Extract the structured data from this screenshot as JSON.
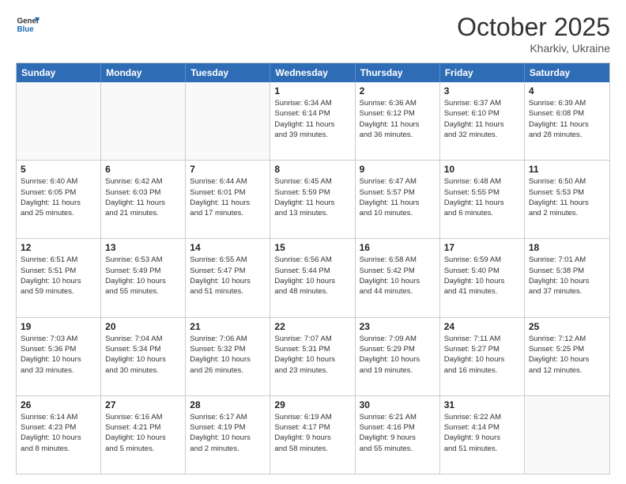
{
  "header": {
    "logo_general": "General",
    "logo_blue": "Blue",
    "month": "October 2025",
    "location": "Kharkiv, Ukraine"
  },
  "weekdays": [
    "Sunday",
    "Monday",
    "Tuesday",
    "Wednesday",
    "Thursday",
    "Friday",
    "Saturday"
  ],
  "rows": [
    [
      {
        "day": "",
        "info": ""
      },
      {
        "day": "",
        "info": ""
      },
      {
        "day": "",
        "info": ""
      },
      {
        "day": "1",
        "info": "Sunrise: 6:34 AM\nSunset: 6:14 PM\nDaylight: 11 hours\nand 39 minutes."
      },
      {
        "day": "2",
        "info": "Sunrise: 6:36 AM\nSunset: 6:12 PM\nDaylight: 11 hours\nand 36 minutes."
      },
      {
        "day": "3",
        "info": "Sunrise: 6:37 AM\nSunset: 6:10 PM\nDaylight: 11 hours\nand 32 minutes."
      },
      {
        "day": "4",
        "info": "Sunrise: 6:39 AM\nSunset: 6:08 PM\nDaylight: 11 hours\nand 28 minutes."
      }
    ],
    [
      {
        "day": "5",
        "info": "Sunrise: 6:40 AM\nSunset: 6:05 PM\nDaylight: 11 hours\nand 25 minutes."
      },
      {
        "day": "6",
        "info": "Sunrise: 6:42 AM\nSunset: 6:03 PM\nDaylight: 11 hours\nand 21 minutes."
      },
      {
        "day": "7",
        "info": "Sunrise: 6:44 AM\nSunset: 6:01 PM\nDaylight: 11 hours\nand 17 minutes."
      },
      {
        "day": "8",
        "info": "Sunrise: 6:45 AM\nSunset: 5:59 PM\nDaylight: 11 hours\nand 13 minutes."
      },
      {
        "day": "9",
        "info": "Sunrise: 6:47 AM\nSunset: 5:57 PM\nDaylight: 11 hours\nand 10 minutes."
      },
      {
        "day": "10",
        "info": "Sunrise: 6:48 AM\nSunset: 5:55 PM\nDaylight: 11 hours\nand 6 minutes."
      },
      {
        "day": "11",
        "info": "Sunrise: 6:50 AM\nSunset: 5:53 PM\nDaylight: 11 hours\nand 2 minutes."
      }
    ],
    [
      {
        "day": "12",
        "info": "Sunrise: 6:51 AM\nSunset: 5:51 PM\nDaylight: 10 hours\nand 59 minutes."
      },
      {
        "day": "13",
        "info": "Sunrise: 6:53 AM\nSunset: 5:49 PM\nDaylight: 10 hours\nand 55 minutes."
      },
      {
        "day": "14",
        "info": "Sunrise: 6:55 AM\nSunset: 5:47 PM\nDaylight: 10 hours\nand 51 minutes."
      },
      {
        "day": "15",
        "info": "Sunrise: 6:56 AM\nSunset: 5:44 PM\nDaylight: 10 hours\nand 48 minutes."
      },
      {
        "day": "16",
        "info": "Sunrise: 6:58 AM\nSunset: 5:42 PM\nDaylight: 10 hours\nand 44 minutes."
      },
      {
        "day": "17",
        "info": "Sunrise: 6:59 AM\nSunset: 5:40 PM\nDaylight: 10 hours\nand 41 minutes."
      },
      {
        "day": "18",
        "info": "Sunrise: 7:01 AM\nSunset: 5:38 PM\nDaylight: 10 hours\nand 37 minutes."
      }
    ],
    [
      {
        "day": "19",
        "info": "Sunrise: 7:03 AM\nSunset: 5:36 PM\nDaylight: 10 hours\nand 33 minutes."
      },
      {
        "day": "20",
        "info": "Sunrise: 7:04 AM\nSunset: 5:34 PM\nDaylight: 10 hours\nand 30 minutes."
      },
      {
        "day": "21",
        "info": "Sunrise: 7:06 AM\nSunset: 5:32 PM\nDaylight: 10 hours\nand 26 minutes."
      },
      {
        "day": "22",
        "info": "Sunrise: 7:07 AM\nSunset: 5:31 PM\nDaylight: 10 hours\nand 23 minutes."
      },
      {
        "day": "23",
        "info": "Sunrise: 7:09 AM\nSunset: 5:29 PM\nDaylight: 10 hours\nand 19 minutes."
      },
      {
        "day": "24",
        "info": "Sunrise: 7:11 AM\nSunset: 5:27 PM\nDaylight: 10 hours\nand 16 minutes."
      },
      {
        "day": "25",
        "info": "Sunrise: 7:12 AM\nSunset: 5:25 PM\nDaylight: 10 hours\nand 12 minutes."
      }
    ],
    [
      {
        "day": "26",
        "info": "Sunrise: 6:14 AM\nSunset: 4:23 PM\nDaylight: 10 hours\nand 8 minutes."
      },
      {
        "day": "27",
        "info": "Sunrise: 6:16 AM\nSunset: 4:21 PM\nDaylight: 10 hours\nand 5 minutes."
      },
      {
        "day": "28",
        "info": "Sunrise: 6:17 AM\nSunset: 4:19 PM\nDaylight: 10 hours\nand 2 minutes."
      },
      {
        "day": "29",
        "info": "Sunrise: 6:19 AM\nSunset: 4:17 PM\nDaylight: 9 hours\nand 58 minutes."
      },
      {
        "day": "30",
        "info": "Sunrise: 6:21 AM\nSunset: 4:16 PM\nDaylight: 9 hours\nand 55 minutes."
      },
      {
        "day": "31",
        "info": "Sunrise: 6:22 AM\nSunset: 4:14 PM\nDaylight: 9 hours\nand 51 minutes."
      },
      {
        "day": "",
        "info": ""
      }
    ]
  ]
}
